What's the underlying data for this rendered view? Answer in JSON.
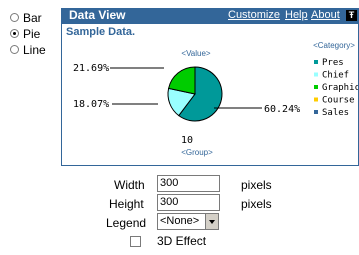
{
  "chart_type_options": [
    {
      "label": "Bar",
      "selected": false
    },
    {
      "label": "Pie",
      "selected": true
    },
    {
      "label": "Line",
      "selected": false
    }
  ],
  "portlet": {
    "title": "Data View",
    "links": {
      "customize": "Customize",
      "help": "Help",
      "about": "About"
    },
    "close_glyph": "Ŧ"
  },
  "chart_data": {
    "type": "pie",
    "title": "Sample Data.",
    "value_label": "<Value>",
    "group_label": "<Group>",
    "legend_title": "<Category>",
    "group_value": "10",
    "slice_labels": [
      "21.69%",
      "18.07%",
      "60.24%"
    ],
    "series": [
      {
        "name": "Pres",
        "value": 60.24,
        "color": "#009999"
      },
      {
        "name": "Chief",
        "value": 18.07,
        "color": "#99ffff"
      },
      {
        "name": "Graphic",
        "value": 21.69,
        "color": "#00cc00"
      }
    ],
    "legend": [
      {
        "name": "Pres",
        "color": "#009999"
      },
      {
        "name": "Chief",
        "color": "#99ffff"
      },
      {
        "name": "Graphic",
        "color": "#00cc00"
      },
      {
        "name": "Course",
        "color": "#ffcc00"
      },
      {
        "name": "Sales",
        "color": "#336699"
      }
    ]
  },
  "form": {
    "width_label": "Width",
    "width_value": "300",
    "width_unit": "pixels",
    "height_label": "Height",
    "height_value": "300",
    "height_unit": "pixels",
    "legend_label": "Legend",
    "legend_value": "<None>",
    "effect_label": "3D Effect",
    "effect_checked": false
  }
}
